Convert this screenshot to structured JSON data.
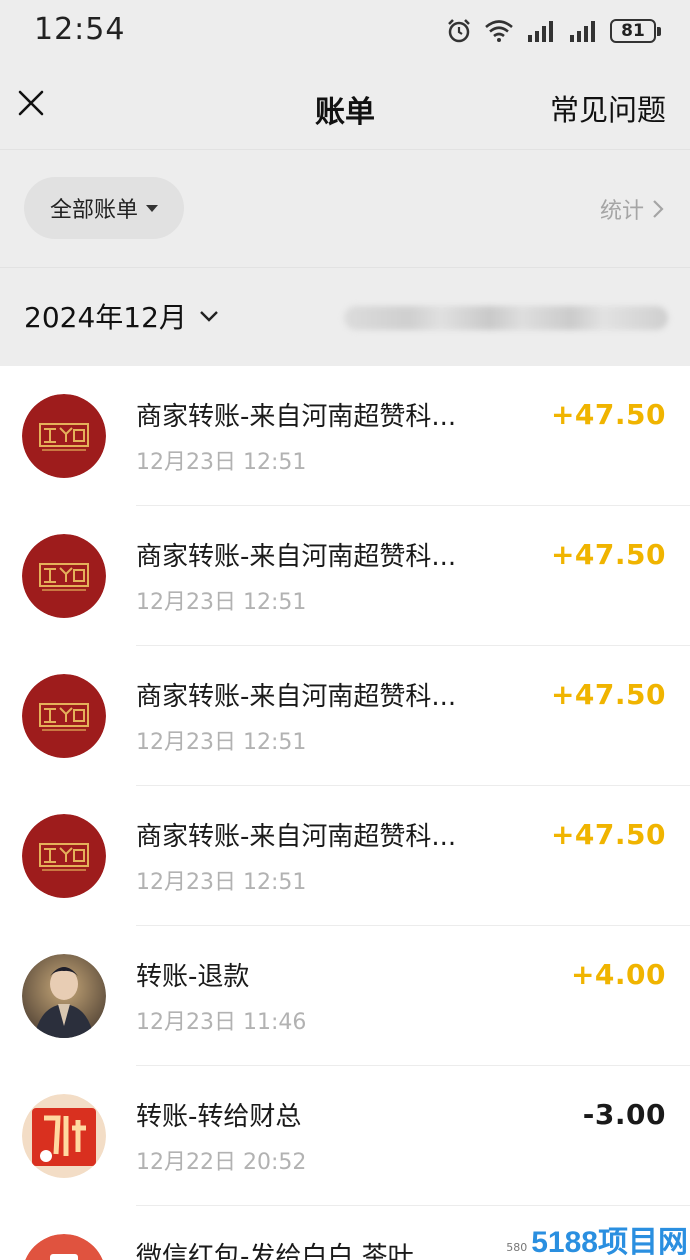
{
  "status_bar": {
    "time": "12:54",
    "battery": "81",
    "icons": [
      "alarm-icon",
      "wifi-icon",
      "signal-icon",
      "signal-icon",
      "battery-icon"
    ]
  },
  "nav": {
    "title": "账单",
    "help_label": "常见问题",
    "close_icon": "close-icon"
  },
  "filter": {
    "label": "全部账单",
    "stats_label": "统计"
  },
  "month": {
    "label": "2024年12月"
  },
  "colors": {
    "income": "#f0b400",
    "expense": "#1a1a1a",
    "avatar_brand": "#9e1c1c"
  },
  "bills": [
    {
      "title": "商家转账-来自河南超赞科...",
      "time": "12月23日 12:51",
      "amount": "+47.50",
      "type": "income",
      "avatar": "brand-logo"
    },
    {
      "title": "商家转账-来自河南超赞科...",
      "time": "12月23日 12:51",
      "amount": "+47.50",
      "type": "income",
      "avatar": "brand-logo"
    },
    {
      "title": "商家转账-来自河南超赞科...",
      "time": "12月23日 12:51",
      "amount": "+47.50",
      "type": "income",
      "avatar": "brand-logo"
    },
    {
      "title": "商家转账-来自河南超赞科...",
      "time": "12月23日 12:51",
      "amount": "+47.50",
      "type": "income",
      "avatar": "brand-logo"
    },
    {
      "title": "转账-退款",
      "time": "12月23日 11:46",
      "amount": "+4.00",
      "type": "income",
      "avatar": "person-photo"
    },
    {
      "title": "转账-转给财总",
      "time": "12月22日 20:52",
      "amount": "-3.00",
      "type": "expense",
      "avatar": "red-poster"
    },
    {
      "title": "微信红包-发给白白 茶叶",
      "time": "",
      "amount": "",
      "type": "expense",
      "avatar": "red-packet"
    }
  ],
  "watermark": {
    "small": "580",
    "big": "5188项目网"
  }
}
